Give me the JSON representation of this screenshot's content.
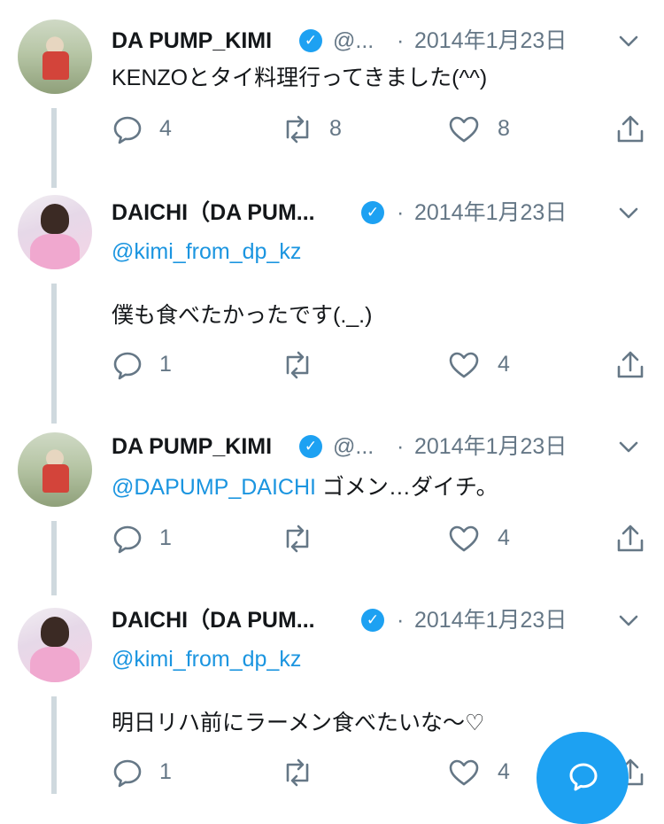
{
  "tweets": [
    {
      "author": "DA PUMP_KIMI",
      "handle": "@...",
      "separator": "·",
      "date": "2014年1月23日",
      "reply_to": "",
      "mention": "",
      "text": "KENZOとタイ料理行ってきました(^^)",
      "replies": "4",
      "retweets": "8",
      "likes": "8",
      "verified": true,
      "avatar": "kimi"
    },
    {
      "author": "DAICHI（DA PUM...",
      "handle": "",
      "separator": "·",
      "date": "2014年1月23日",
      "reply_to": "@kimi_from_dp_kz",
      "mention": "",
      "text": "僕も食べたかったです(._.)",
      "replies": "1",
      "retweets": "",
      "likes": "4",
      "verified": true,
      "avatar": "daichi"
    },
    {
      "author": "DA PUMP_KIMI",
      "handle": "@...",
      "separator": "·",
      "date": "2014年1月23日",
      "reply_to": "",
      "mention": "@DAPUMP_DAICHI",
      "text": " ゴメン…ダイチ。",
      "replies": "1",
      "retweets": "",
      "likes": "4",
      "verified": true,
      "avatar": "kimi"
    },
    {
      "author": "DAICHI（DA PUM...",
      "handle": "",
      "separator": "·",
      "date": "2014年1月23日",
      "reply_to": "@kimi_from_dp_kz",
      "mention": "",
      "text": "明日リハ前にラーメン食べたいな〜♡",
      "replies": "1",
      "retweets": "",
      "likes": "4",
      "verified": true,
      "avatar": "daichi"
    }
  ],
  "icons": {
    "reply": "reply-icon",
    "retweet": "retweet-icon",
    "like": "heart-icon",
    "share": "share-icon",
    "verified": "verified-badge-icon",
    "menu": "chevron-down-icon",
    "compose": "compose-icon"
  },
  "colors": {
    "accent": "#1da1f2",
    "link": "#1b95e0",
    "secondary_text": "#657786",
    "thread_line": "#cfd9de"
  }
}
